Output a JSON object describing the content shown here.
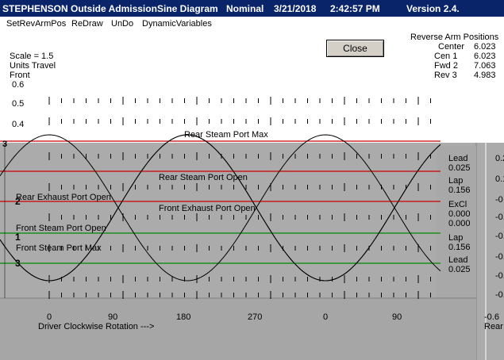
{
  "titlebar": {
    "app": "STEPHENSON Outside Admission",
    "view": "Sine Diagram",
    "mode": "Nominal",
    "date": "3/21/2018",
    "time": "2:42:57 PM",
    "version": "Version 2.4."
  },
  "menu": [
    "SetRevArmPos",
    "ReDraw",
    "UnDo",
    "DynamicVariables"
  ],
  "close_label": "Close",
  "info": {
    "scale": "Scale = 1.5",
    "units": "Units Travel",
    "side": "Front"
  },
  "reverse_arm": {
    "title": "Reverse Arm Positions",
    "rows": [
      {
        "label": "Center",
        "value": "6.023"
      },
      {
        "label": "Cen 1",
        "value": "6.023"
      },
      {
        "label": "Fwd 2",
        "value": "7.063"
      },
      {
        "label": "Rev 3",
        "value": "4.983"
      }
    ]
  },
  "upper_ticks": [
    "0.6",
    "0.5",
    "0.4"
  ],
  "marker_3": "3",
  "port_labels": {
    "rear_steam_max": "Rear Steam Port Max",
    "rear_steam_open": "Rear Steam Port Open",
    "rear_exhaust_open": "Rear Exhaust Port Open",
    "front_exhaust_open": "Front Exhaust Port Open",
    "front_steam_open": "Front Steam Port Open",
    "front_steam_max": "Front Steam Port Max"
  },
  "curve_labels": [
    "2",
    "1",
    "3"
  ],
  "right_values": [
    {
      "label": "Lead",
      "value": "0.025"
    },
    {
      "label": "Lap",
      "value": "0.156"
    },
    {
      "label": "ExCl",
      "value": "0.000"
    },
    {
      "label": "",
      "value": "0.000"
    },
    {
      "label": "Lap",
      "value": "0.156"
    },
    {
      "label": "Lead",
      "value": "0.025"
    }
  ],
  "x_ticks": [
    "0",
    "90",
    "180",
    "270",
    "0",
    "90"
  ],
  "x_label": "Driver Clockwise Rotation --->",
  "right_panel": {
    "values": [
      "0.2",
      "0.1",
      "-0",
      "-0.",
      "-0.",
      "-0.",
      "-0.",
      "-0.",
      "-0."
    ],
    "bottom": "-0.6",
    "bottom2": "Rear"
  },
  "colors": {
    "title_bg": "#0a246a",
    "red_line": "#cc0000",
    "green_line": "#008800",
    "plot_bg": "#ababab"
  }
}
